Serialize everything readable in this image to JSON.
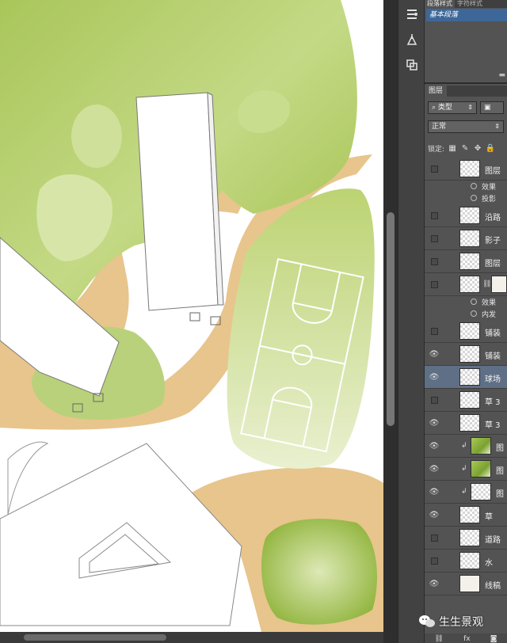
{
  "colors": {
    "grass": "#b6cf6a",
    "grass_dark": "#8fb33a",
    "path": "#e7c58c",
    "building": "#ffffff",
    "panel": "#535353",
    "selected": "#5f6f86"
  },
  "paragraph_panel": {
    "tabs": [
      "段落样式",
      "字符样式"
    ],
    "style_item": "基本段落"
  },
  "tool_strip": {
    "icons": [
      "paragraph-style-icon",
      "brush-preset-icon",
      "clone-source-icon"
    ]
  },
  "layers_panel": {
    "tab": "图层",
    "filter_label": "类型",
    "blend_mode": "正常",
    "lock_label": "锁定:",
    "layers": [
      {
        "kind": "effect",
        "name": "投影"
      },
      {
        "kind": "layer",
        "name": "图层",
        "visible": false,
        "thumb": "transparent"
      },
      {
        "kind": "effect",
        "name": "效果"
      },
      {
        "kind": "effect",
        "name": "投影"
      },
      {
        "kind": "layer",
        "name": "沿路",
        "visible": false,
        "thumb": "transparent"
      },
      {
        "kind": "layer",
        "name": "影子",
        "visible": false,
        "thumb": "transparent"
      },
      {
        "kind": "layer",
        "name": "图层",
        "visible": false,
        "thumb": "transparent"
      },
      {
        "kind": "layer",
        "name": "",
        "visible": false,
        "thumb": "transparent",
        "linked": true
      },
      {
        "kind": "effect",
        "name": "效果"
      },
      {
        "kind": "effect",
        "name": "内发"
      },
      {
        "kind": "layer",
        "name": "铺装",
        "visible": false,
        "thumb": "transparent"
      },
      {
        "kind": "layer",
        "name": "铺装",
        "visible": true,
        "thumb": "transparent"
      },
      {
        "kind": "layer",
        "name": "球场",
        "visible": true,
        "thumb": "transparent",
        "selected": true
      },
      {
        "kind": "layer",
        "name": "草 3",
        "visible": false,
        "thumb": "transparent"
      },
      {
        "kind": "layer",
        "name": "草 3",
        "visible": true,
        "thumb": "transparent"
      },
      {
        "kind": "layer",
        "name": "图",
        "visible": true,
        "thumb": "green",
        "clipped": true
      },
      {
        "kind": "layer",
        "name": "图",
        "visible": true,
        "thumb": "green",
        "clipped": true
      },
      {
        "kind": "layer",
        "name": "图",
        "visible": true,
        "thumb": "transparent",
        "clipped": true
      },
      {
        "kind": "layer",
        "name": "草",
        "visible": true,
        "thumb": "transparent"
      },
      {
        "kind": "layer",
        "name": "道路",
        "visible": false,
        "thumb": "transparent"
      },
      {
        "kind": "layer",
        "name": "水",
        "visible": false,
        "thumb": "transparent"
      },
      {
        "kind": "layer",
        "name": "线稿",
        "visible": true,
        "thumb": "light"
      }
    ],
    "footer_icons": [
      "link-icon",
      "fx-icon",
      "mask-icon"
    ]
  },
  "watermark": "生生景观"
}
